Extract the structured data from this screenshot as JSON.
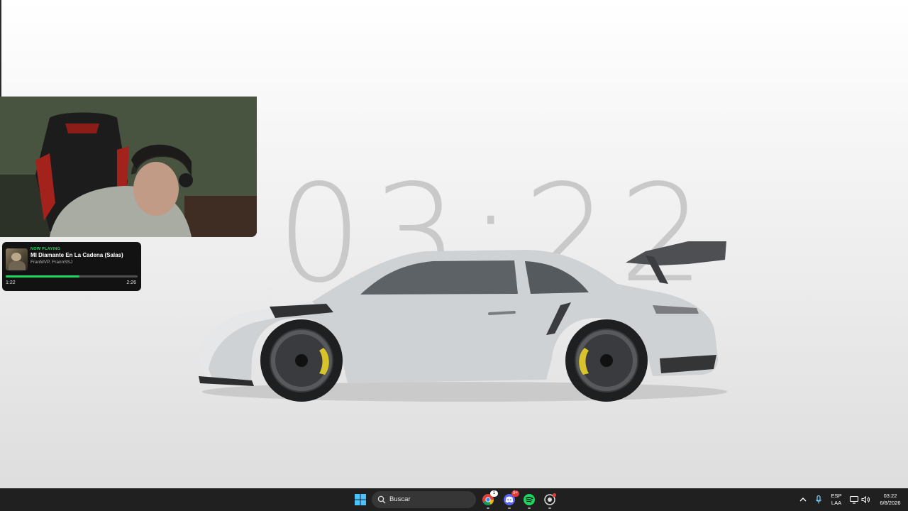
{
  "wallpaper": {
    "clock": "03:22"
  },
  "now_playing": {
    "status": "NOW PLAYING",
    "title": "MI Diamante En La Cadena (Salas)",
    "artist": "FranMVP, FrannSSJ",
    "elapsed": "1:22",
    "total": "2:26",
    "progress": 0.56,
    "accent_color": "#1ed760"
  },
  "taskbar": {
    "search_placeholder": "Buscar",
    "apps": [
      {
        "name": "chrome-icon",
        "badge": "1"
      },
      {
        "name": "discord-icon",
        "badge": "9+"
      },
      {
        "name": "spotify-icon",
        "badge": ""
      },
      {
        "name": "app-icon",
        "badge": "•"
      }
    ],
    "language": {
      "line1": "ESP",
      "line2": "LAA"
    },
    "clock": {
      "time": "03:22",
      "date": "6/8/2026"
    }
  }
}
